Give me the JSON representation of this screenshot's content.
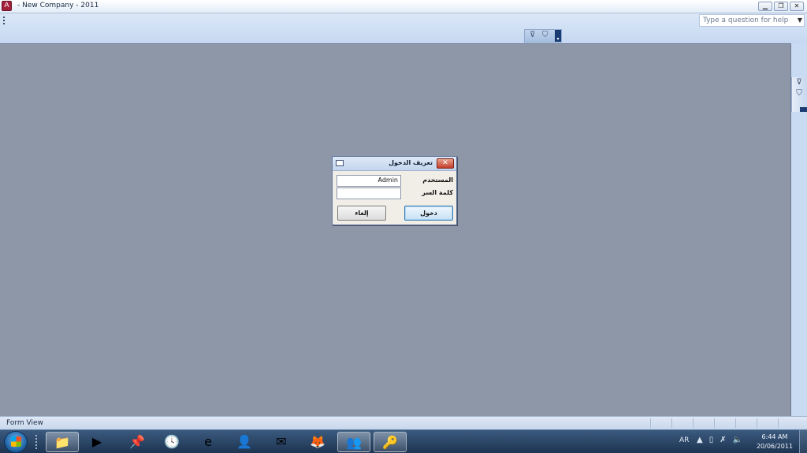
{
  "window": {
    "title": "- New Company - 2011",
    "app_icon": "access-icon",
    "buttons": [
      "minimize-icon",
      "restore-icon",
      "close-icon"
    ]
  },
  "ribbon": {
    "help_placeholder": "Type a question for help",
    "filter_icons": [
      "filter-clear-icon",
      "filter-icon"
    ]
  },
  "dialog": {
    "title": "تعريف الدخول",
    "user_label": "المستخدم",
    "user_value": "Admin",
    "password_label": "كلمة السر",
    "password_value": "",
    "login_label": "دخول",
    "cancel_label": "إلغاء"
  },
  "statusbar": {
    "view": "Form View"
  },
  "taskbar": {
    "items": [
      {
        "name": "file-explorer-icon",
        "glyph": "📁"
      },
      {
        "name": "media-player-icon",
        "glyph": "▶"
      },
      {
        "name": "pushpin-icon",
        "glyph": "📌"
      },
      {
        "name": "clock-icon",
        "glyph": "🕓"
      },
      {
        "name": "internet-explorer-icon",
        "glyph": "e"
      },
      {
        "name": "messenger-icon",
        "glyph": "👤"
      },
      {
        "name": "mail-icon",
        "glyph": "✉"
      },
      {
        "name": "firefox-icon",
        "glyph": "🦊"
      },
      {
        "name": "windows-live-messenger-icon",
        "glyph": "👥"
      },
      {
        "name": "access-icon",
        "glyph": "🔑"
      }
    ],
    "language": "AR",
    "time": "6:44 AM",
    "date": "20/06/2011"
  }
}
